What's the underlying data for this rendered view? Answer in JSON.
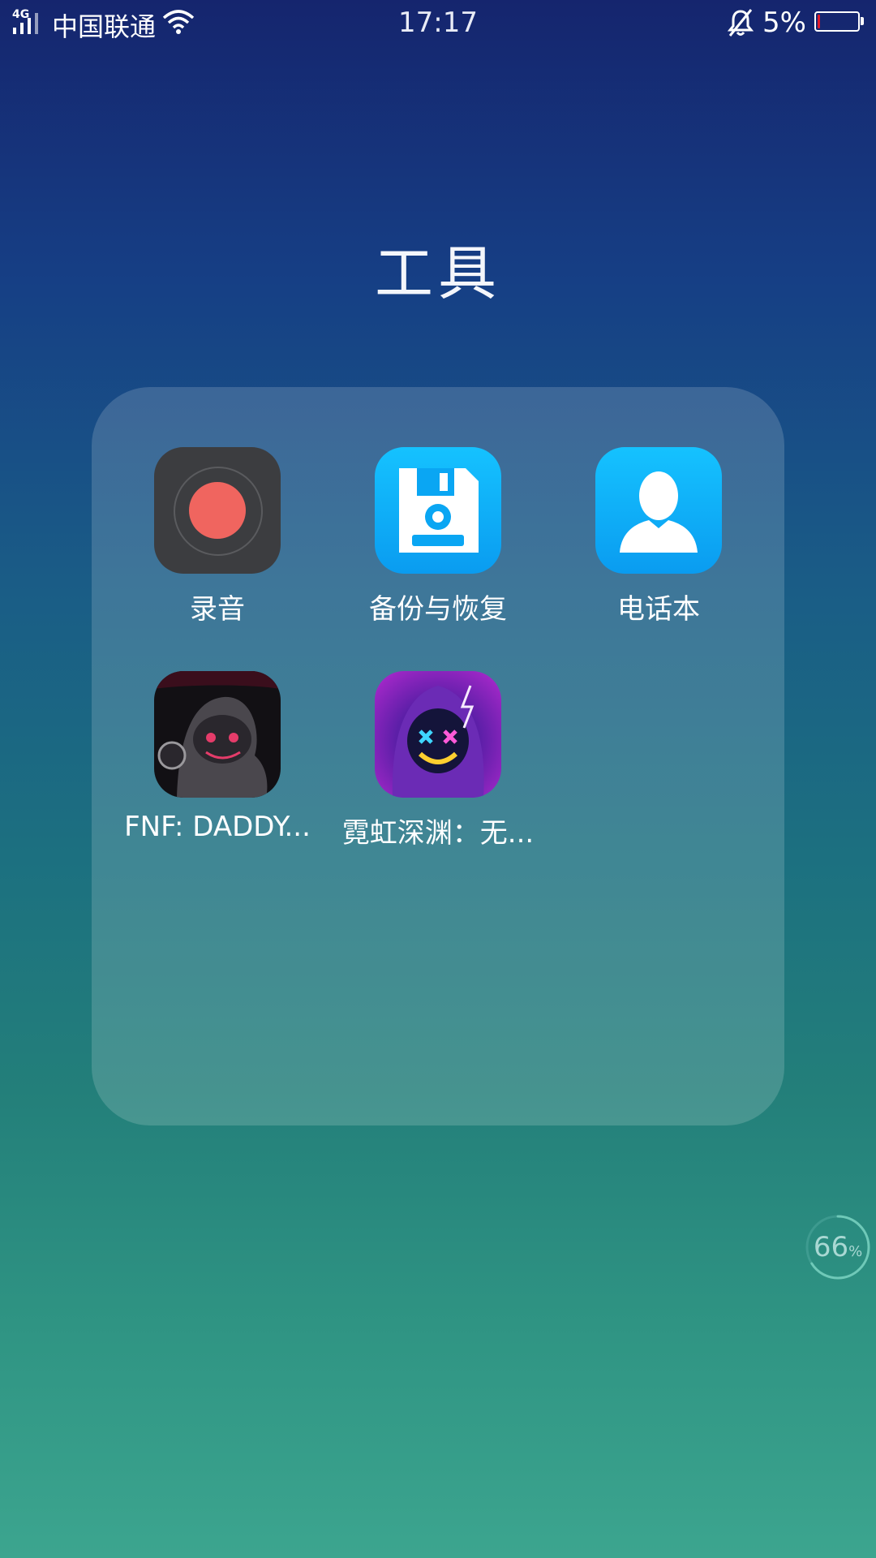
{
  "status_bar": {
    "network_type": "4G",
    "carrier": "中国联通",
    "time": "17:17",
    "battery_percent": "5%",
    "battery_level": 0.05,
    "icons": [
      "signal-icon",
      "wifi-icon",
      "bell-muted-icon",
      "battery-icon"
    ]
  },
  "folder": {
    "title": "工具",
    "apps": [
      {
        "label": "录音",
        "icon": "recorder-icon"
      },
      {
        "label": "备份与恢复",
        "icon": "backup-restore-icon"
      },
      {
        "label": "电话本",
        "icon": "contacts-icon"
      },
      {
        "label": "FNF: DADDY...",
        "icon": "fnf-daddy-icon"
      },
      {
        "label": "霓虹深渊：无...",
        "icon": "neon-abyss-icon"
      }
    ]
  },
  "memory_widget": {
    "value": "66",
    "unit": "%",
    "level": 0.66
  },
  "colors": {
    "recorder_red": "#f0655f",
    "app_blue": "#0a9cf0",
    "battery_low": "#e21a2b"
  }
}
